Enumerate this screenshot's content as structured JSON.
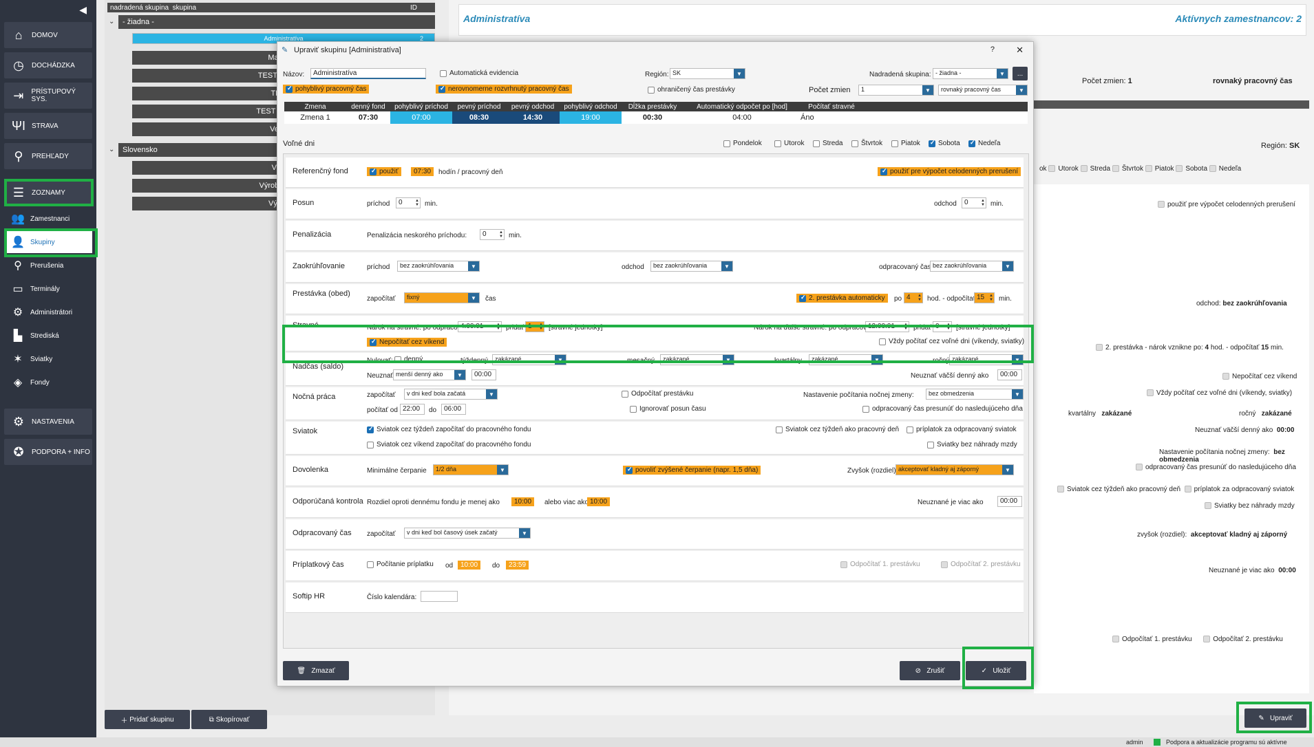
{
  "sidebar": {
    "main": [
      {
        "label": "DOMOV",
        "icon": "home-icon"
      },
      {
        "label": "DOCHÁDZKA",
        "icon": "clock-icon"
      },
      {
        "label": "PRÍSTUPOVÝ SYS.",
        "icon": "login-icon"
      },
      {
        "label": "STRAVA",
        "icon": "cutlery-icon"
      },
      {
        "label": "PREHĽADY",
        "icon": "search-icon"
      }
    ],
    "zoznamy": "ZOZNAMY",
    "sub": [
      {
        "label": "Zamestnanci",
        "icon": "people-icon"
      },
      {
        "label": "Skupiny",
        "icon": "group-icon"
      },
      {
        "label": "Prerušenia",
        "icon": "pin-icon"
      },
      {
        "label": "Terminály",
        "icon": "terminal-icon"
      },
      {
        "label": "Administrátori",
        "icon": "admin-icon"
      },
      {
        "label": "Strediská",
        "icon": "building-icon"
      },
      {
        "label": "Sviatky",
        "icon": "party-icon"
      },
      {
        "label": "Fondy",
        "icon": "layers-icon"
      }
    ],
    "nastavenia": "NASTAVENIA",
    "podpora": "PODPORA + INFO"
  },
  "tree": {
    "header": {
      "parent": "nadradená skupina",
      "group": "skupina",
      "id": "ID"
    },
    "group1": "- žiadna -",
    "group1_items": [
      "Administratíva",
      "Manažéri",
      "TEST - dohoda",
      "TEST 2",
      "TEST SKUPINA",
      "Vedenie"
    ],
    "selected_id": "2",
    "group2": "Slovensko",
    "group2_items": [
      "Výroba",
      "Výroba - kópia",
      "Výroba 2"
    ],
    "add_button": "Pridať skupinu",
    "copy_button": "Skopírovať"
  },
  "right": {
    "title": "Administratíva",
    "active_employees": "Aktívnych zamestnancov: 2",
    "shifts_label": "Počet zmien:",
    "shifts_value": "1",
    "even_time": "rovnaký pracovný čas",
    "region_label": "Región:",
    "region_value": "SK",
    "days": [
      "ok",
      "Utorok",
      "Streda",
      "Štvrtok",
      "Piatok",
      "Sobota",
      "Nedeľa"
    ],
    "use_full_day": "použiť pre výpočet celodenných prerušení",
    "departure_label": "odchod:",
    "departure_value": "bez zaokrúhľovania",
    "break2": "2. prestávka - nárok vznikne po:",
    "break2_hours": "4",
    "break2_mid": "hod. - odpočítať",
    "break2_min": "15",
    "break2_unit": "min.",
    "no_weekend": "Nepočítať cez víkend",
    "always_free": "Vždy počítať cez voľné dni (víkendy, sviatky)",
    "quarterly_label": "kvartálny",
    "quarterly_value": "zakázané",
    "yearly_label": "ročný",
    "yearly_value": "zakázané",
    "not_accept_more": "Neuznať väčší denný ako",
    "not_accept_more_val": "00:00",
    "night_label": "Nastavenie počítania nočnej zmeny:",
    "night_value": "bez obmedzenia",
    "worked_move": "odpracovaný čas presunúť do nasledujúceho dňa",
    "holiday_week": "Sviatok cez týždeň ako pracovný deň",
    "holiday_bonus": "príplatok za odpracovaný sviatok",
    "holiday_nocomp": "Sviatky bez náhrady mzdy",
    "increase_label": "zvyšok (rozdiel):",
    "increase_value": "akceptovať kladný aj záporný",
    "not_more_label": "Neuznané je viac ako",
    "not_more_val": "00:00",
    "sub_break1": "Odpočítať 1. prestávku",
    "sub_break2": "Odpočítať 2. prestávku",
    "edit_button": "Upraviť"
  },
  "statusbar": {
    "user": "admin",
    "message": "Podpora a aktualizácie programu sú aktívne"
  },
  "dialog": {
    "title": "Upraviť skupinu [Administratíva]",
    "help": "?",
    "close": "✕",
    "name_label": "Názov:",
    "name_value": "Administratíva",
    "auto_evid": "Automatická evidencia",
    "region_label": "Región:",
    "region_value": "SK",
    "parent_label": "Nadradená skupina:",
    "parent_value": "- žiadna -",
    "more": "...",
    "flex_time": "pohyblivý pracovný čas",
    "uneven_time": "nerovnomerne rozvrhnutý pracovný čas",
    "limited_break": "ohraničený čas prestávky",
    "shifts_label": "Počet zmien",
    "shifts_value": "1",
    "even_time": "rovnaký pracovný čas",
    "shift_headers": [
      "Zmena",
      "denný fond",
      "pohyblivý príchod",
      "pevný príchod",
      "pevný odchod",
      "pohyblivý odchod",
      "Dĺžka prestávky",
      "Automatický odpočet po [hod]",
      "Počítať stravné"
    ],
    "shift_row": [
      "Zmena 1",
      "07:30",
      "07:00",
      "08:30",
      "14:30",
      "19:00",
      "00:30",
      "04:00",
      "Áno"
    ],
    "free_days_label": "Voľné dni",
    "days": [
      "Pondelok",
      "Utorok",
      "Streda",
      "Štvrtok",
      "Piatok",
      "Sobota",
      "Nedeľa"
    ],
    "ref": {
      "title": "Referenčný fond",
      "use": "použiť",
      "hours": "07:30",
      "unit": "hodín / pracovný deň",
      "full_day": "použiť pre výpočet celodenných prerušení"
    },
    "posun": {
      "title": "Posun",
      "arrival": "príchod",
      "arr_val": "0",
      "min": "min.",
      "departure": "odchod",
      "dep_val": "0"
    },
    "pen": {
      "title": "Penalizácia",
      "label": "Penalizácia neskorého príchodu:",
      "val": "0",
      "min": "min."
    },
    "round": {
      "title": "Zaokrúhľovanie",
      "arrival": "príchod",
      "departure": "odchod",
      "worked": "odpracovaný čas",
      "none": "bez zaokrúhľovania"
    },
    "brk": {
      "title": "Prestávka (obed)",
      "count": "započítať",
      "type": "fixný",
      "time": "čas",
      "auto2": "2. prestávka automaticky",
      "after": "po",
      "hours": "4",
      "mid": "hod. - odpočítať",
      "min": "15",
      "unit": "min."
    },
    "meal": {
      "title": "Stravné",
      "claim": "Nárok na stravné: po odpracovaní",
      "claim_val": "4:00:01",
      "add": "pridať",
      "add_val": "1",
      "units": "[stravné jednotky]",
      "next": "Nárok na ďalše stravné: po odpracovaní",
      "next_val": "12:00:01",
      "add2_val": "0",
      "no_weekend": "Nepočítať cez víkend",
      "always": "Vždy počítať cez voľné dni (víkendy, sviatky)"
    },
    "over": {
      "title": "Nadčas (saldo)",
      "reset": "Nulovať:",
      "daily": "denný",
      "weekly": "týždenný",
      "monthly": "mesačný",
      "quarterly": "kvartálny",
      "yearly": "ročný",
      "forbidden": "zakázané",
      "notaccept": "Neuznať",
      "less": "menší denný ako",
      "less_val": "00:00",
      "more": "Neuznať väčší denný ako",
      "more_val": "00:00"
    },
    "night": {
      "title": "Nočná práca",
      "count": "započítať",
      "mode": "v dni keď bola začatá",
      "sub_break": "Odpočítať prestávku",
      "setting": "Nastavenie počítania nočnej zmeny:",
      "setting_val": "bez obmedzenia",
      "from": "počítať od",
      "from_val": "22:00",
      "to": "do",
      "to_val": "06:00",
      "ignore": "Ignorovať posun času",
      "move": "odpracovaný čas presunúť do nasledujúceho dňa"
    },
    "hol": {
      "title": "Sviatok",
      "week": "Sviatok cez týždeň započítať do pracovného fondu",
      "week_work": "Sviatok cez týždeň ako pracovný deň",
      "bonus": "príplatok za odpracovaný sviatok",
      "weekend": "Sviatok cez víkend započítať do pracovného fondu",
      "nocomp": "Sviatky bez náhrady mzdy"
    },
    "vac": {
      "title": "Dovolenka",
      "min_label": "Minimálne čerpanie",
      "min_val": "1/2 dňa",
      "allow": "povoliť zvýšené čerpanie (napr. 1,5 dňa)",
      "rest": "Zvyšok (rozdiel)",
      "rest_val": "akceptovať kladný aj záporný"
    },
    "ctrl": {
      "title": "Odporúčaná kontrola",
      "diff": "Rozdiel oproti dennému fondu je menej ako",
      "less_val": "10:00",
      "ormore": "alebo viac ako",
      "more_val": "10:00",
      "notmore": "Neuznané je viac ako",
      "notmore_val": "00:00"
    },
    "work": {
      "title": "Odpracovaný čas",
      "count": "započítať",
      "mode": "v dni keď bol časový úsek začatý"
    },
    "bon": {
      "title": "Príplatkový čas",
      "count": "Počítanie príplatku",
      "from": "od",
      "from_val": "10:00",
      "to": "do",
      "to_val": "23:59",
      "b1": "Odpočítať 1. prestávku",
      "b2": "Odpočítať 2. prestávku"
    },
    "softip": {
      "title": "Softip HR",
      "label": "Číslo kalendára:"
    },
    "delete": "Zmazať",
    "cancel": "Zrušiť",
    "save": "Uložiť"
  }
}
